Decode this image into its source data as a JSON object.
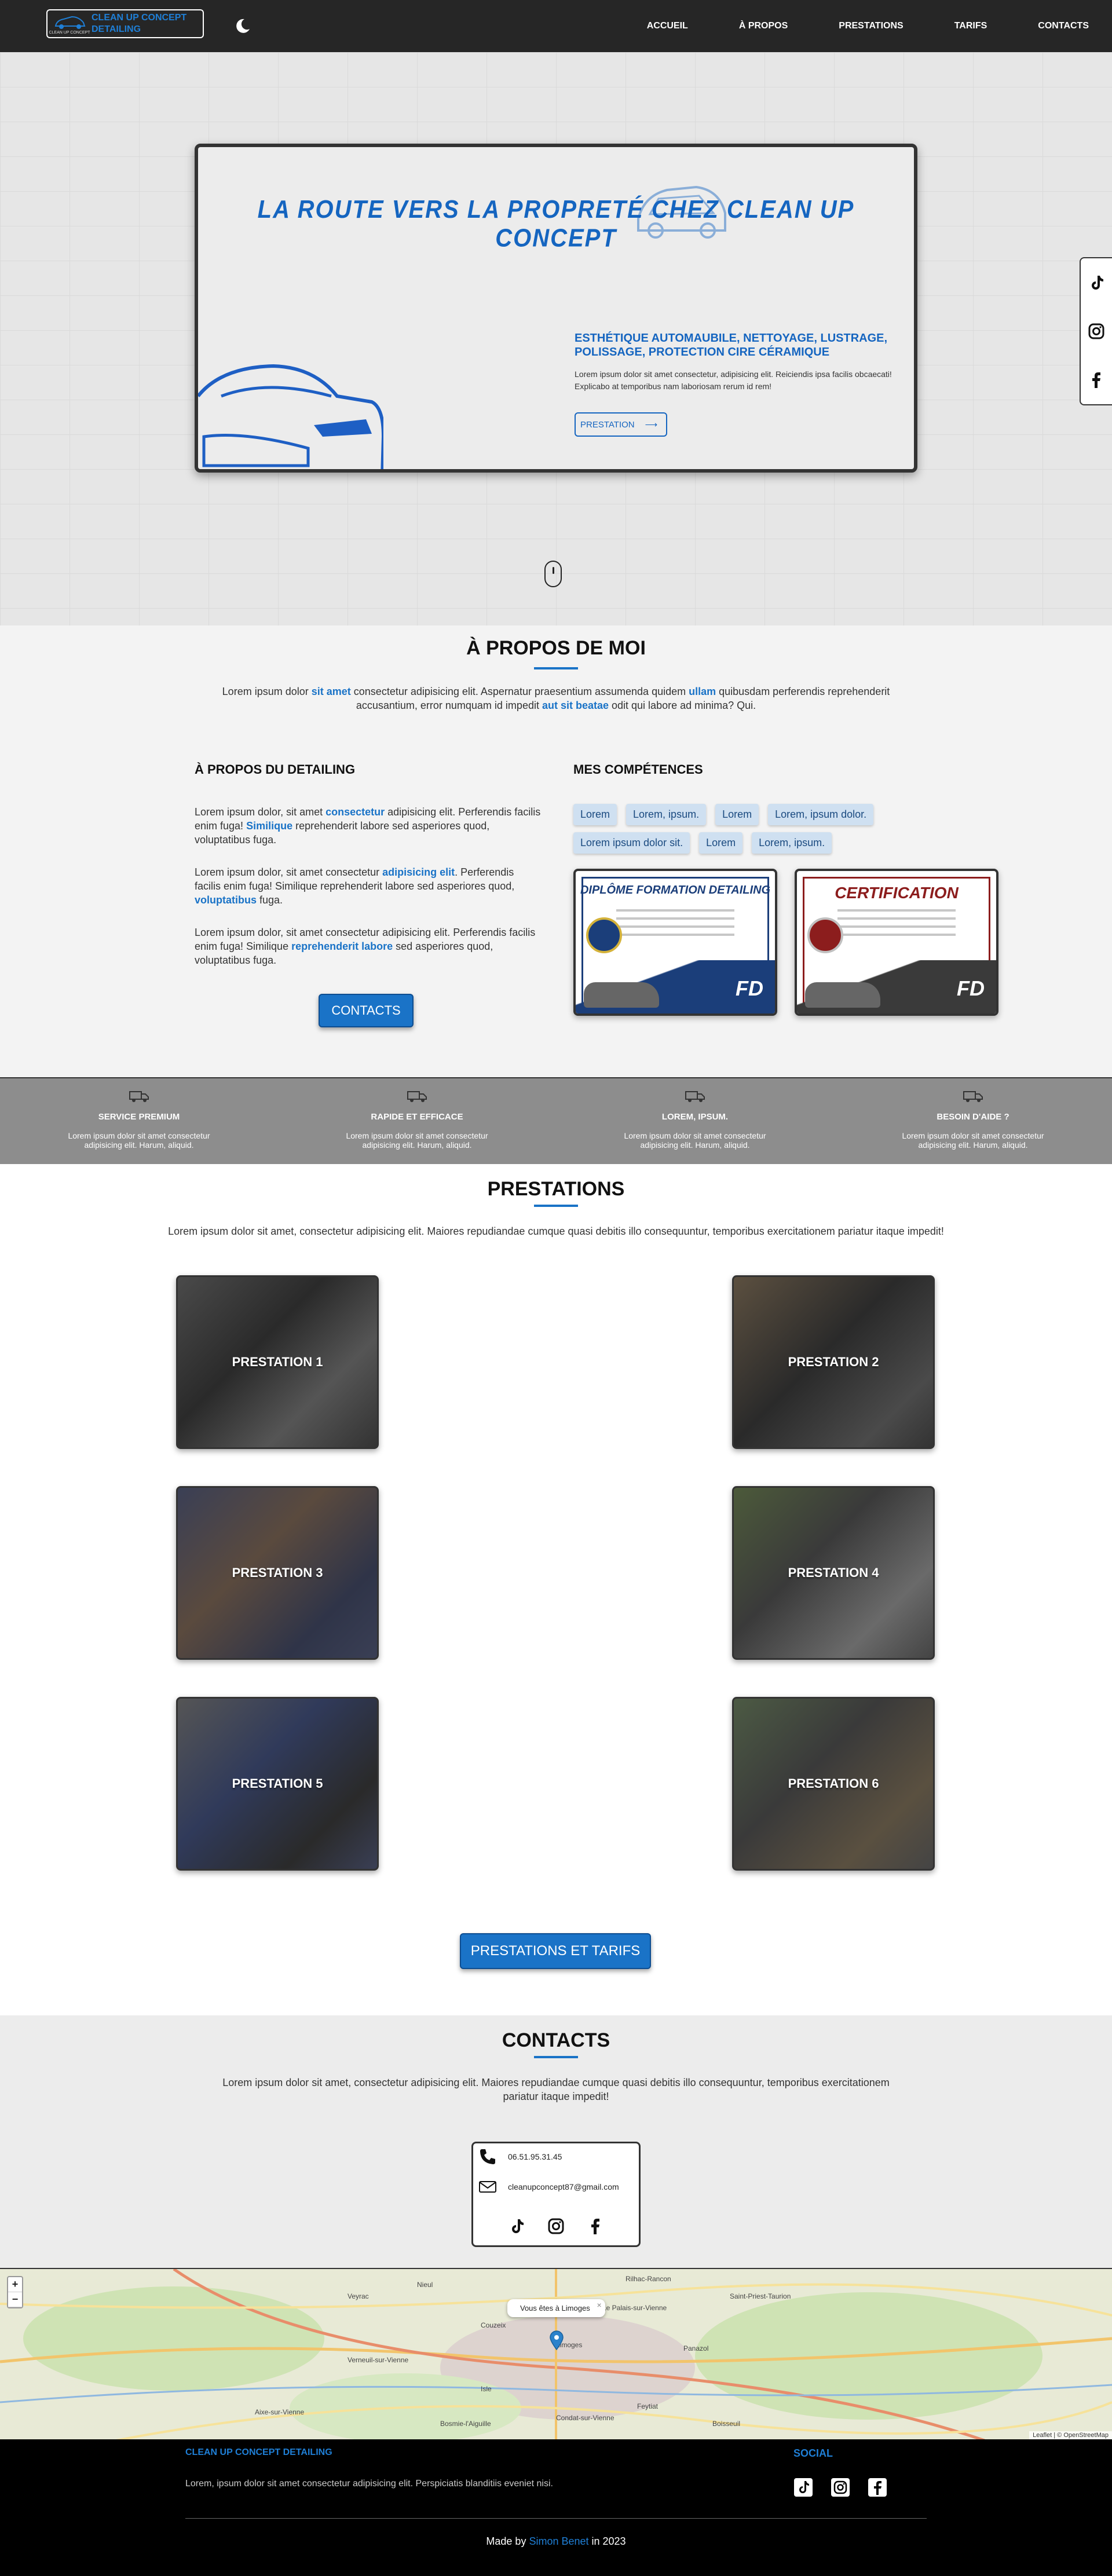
{
  "nav": {
    "logo_line1": "CLEAN UP CONCEPT",
    "logo_line2": "DETAILING",
    "logo_tiny": "CLEAN UP CONCEPT",
    "links": [
      "ACCUEIL",
      "À PROPOS",
      "PRESTATIONS",
      "TARIFS",
      "CONTACTS"
    ]
  },
  "hero": {
    "title": "LA ROUTE VERS LA PROPRETÉ CHEZ CLEAN UP CONCEPT",
    "subtitle": "ESTHÉTIQUE AUTOMAUBILE, NETTOYAGE, LUSTRAGE, POLISSAGE, PROTECTION CIRE CÉRAMIQUE",
    "text": "Lorem ipsum dolor sit amet consectetur, adipisicing elit. Reiciendis ipsa facilis obcaecati! Explicabo at temporibus nam laboriosam rerum id rem!",
    "button": "PRESTATION",
    "arrow": "⟶"
  },
  "about": {
    "title": "À PROPOS DE MOI",
    "intro": [
      "Lorem ipsum dolor ",
      "sit amet",
      " consectetur adipisicing elit. Aspernatur praesentium assumenda quidem ",
      "ullam",
      " quibusdam perferendis reprehenderit accusantium, error numquam id impedit ",
      "aut sit beatae",
      " odit qui labore ad minima? Qui."
    ],
    "detailing_title": "À PROPOS DU DETAILING",
    "p1": [
      "Lorem ipsum dolor, sit amet ",
      "consectetur",
      " adipisicing elit. Perferendis facilis enim fuga! ",
      "Similique",
      " reprehenderit labore sed asperiores quod, voluptatibus fuga."
    ],
    "p2": [
      "Lorem ipsum dolor, sit amet consectetur ",
      "adipisicing elit",
      ". Perferendis facilis enim fuga! Similique reprehenderit labore sed asperiores quod, ",
      "voluptatibus",
      " fuga."
    ],
    "p3": [
      "Lorem ipsum dolor, sit amet consectetur adipisicing elit. Perferendis facilis enim fuga! Similique ",
      "reprehenderit labore",
      " sed asperiores quod, voluptatibus fuga."
    ],
    "contact_button": "CONTACTS",
    "skills_title": "MES COMPÉTENCES",
    "skills": [
      "Lorem",
      "Lorem, ipsum.",
      "Lorem",
      "Lorem, ipsum dolor.",
      "Lorem ipsum dolor sit.",
      "Lorem",
      "Lorem, ipsum."
    ],
    "cert1_title": "DIPLÔME FORMATION DETAILING",
    "cert2_title": "CERTIFICATION",
    "cert_logo": "FD"
  },
  "features": [
    {
      "title": "SERVICE PREMIUM",
      "text": "Lorem ipsum dolor sit amet consectetur adipisicing elit. Harum, aliquid."
    },
    {
      "title": "RAPIDE ET EFFICACE",
      "text": "Lorem ipsum dolor sit amet consectetur adipisicing elit. Harum, aliquid."
    },
    {
      "title": "LOREM, IPSUM.",
      "text": "Lorem ipsum dolor sit amet consectetur adipisicing elit. Harum, aliquid."
    },
    {
      "title": "BESOIN D'AIDE ?",
      "text": "Lorem ipsum dolor sit amet consectetur adipisicing elit. Harum, aliquid."
    }
  ],
  "prestations": {
    "title": "PRESTATIONS",
    "intro": "Lorem ipsum dolor sit amet, consectetur adipisicing elit. Maiores repudiandae cumque quasi debitis illo consequuntur, temporibus exercitationem pariatur itaque impedit!",
    "items": [
      "PRESTATION 1",
      "PRESTATION 2",
      "PRESTATION 3",
      "PRESTATION 4",
      "PRESTATION 5",
      "PRESTATION 6"
    ],
    "button": "PRESTATIONS ET TARIFS"
  },
  "contacts": {
    "title": "CONTACTS",
    "intro": "Lorem ipsum dolor sit amet, consectetur adipisicing elit. Maiores repudiandae cumque quasi debitis illo consequuntur, temporibus exercitationem pariatur itaque impedit!",
    "phone": "06.51.95.31.45",
    "email": "cleanupconcept87@gmail.com"
  },
  "map": {
    "popup": "Vous êtes à Limoges",
    "attribution": "Leaflet | © OpenStreetMap",
    "cities": [
      "Limoges",
      "Isle",
      "Couzeix",
      "Panazol",
      "Feytiat",
      "Le Palais-sur-Vienne",
      "Saint-Priest-Taurion",
      "Veyrac",
      "Verneuil-sur-Vienne",
      "Condat-sur-Vienne",
      "Rilhac-Rancon",
      "Nieul",
      "Bosmie-l'Aiguille",
      "Boisseuil",
      "Aixe-sur-Vienne"
    ]
  },
  "footer": {
    "brand": "CLEAN UP CONCEPT DETAILING",
    "desc": "Lorem, ipsum dolor sit amet consectetur adipisicing elit. Perspiciatis blanditiis eveniet nisi.",
    "social_title": "SOCIAL",
    "made_prefix": "Made by ",
    "made_name": "Simon Benet",
    "made_suffix": " in 2023"
  },
  "colors": {
    "accent": "#1a73c7",
    "hero_title": "#1565c0",
    "nav_bg": "#262626",
    "features_bg": "#8d8d8d"
  }
}
